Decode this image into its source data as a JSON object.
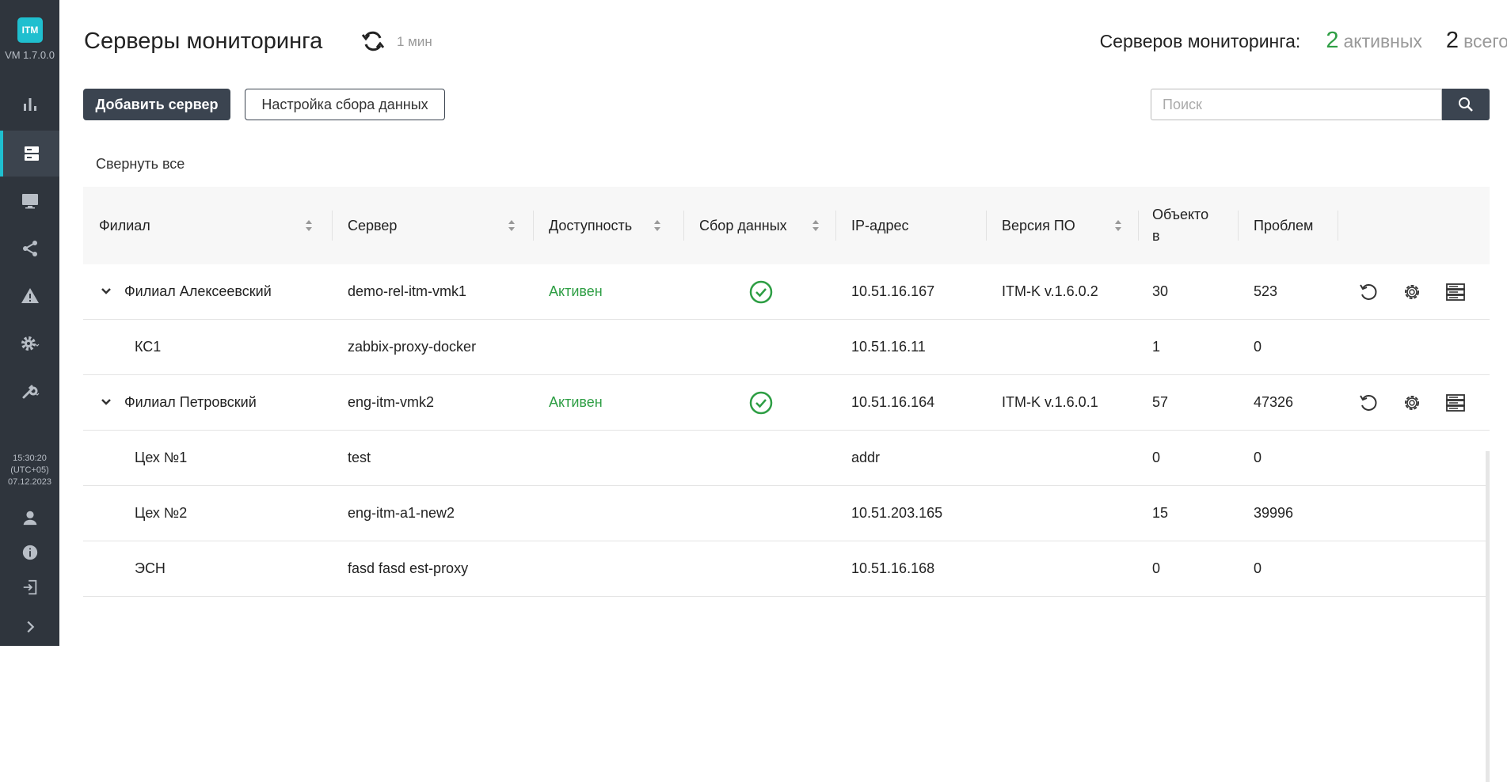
{
  "sidebar": {
    "logo_text": "ITM",
    "version": "VM 1.7.0.0",
    "clock_time": "15:30:20",
    "clock_tz": "(UTC+05)",
    "clock_date": "07.12.2023",
    "nav": [
      {
        "icon": "bar-chart-icon"
      },
      {
        "icon": "servers-icon",
        "active": true
      },
      {
        "icon": "monitor-icon"
      },
      {
        "icon": "share-icon"
      },
      {
        "icon": "warning-icon"
      },
      {
        "icon": "gear-icon"
      },
      {
        "icon": "wrench-icon"
      }
    ],
    "bottom": [
      {
        "icon": "user-icon"
      },
      {
        "icon": "info-icon"
      },
      {
        "icon": "logout-icon"
      },
      {
        "icon": "expand-chevron-icon"
      }
    ],
    "accent_color": "#1fbfcf",
    "bg_color": "#2f353d"
  },
  "header": {
    "title": "Серверы мониторинга",
    "refresh_interval": "1 мин",
    "summary_label": "Серверов мониторинга:",
    "active_count": "2",
    "active_label": "активных",
    "total_count": "2",
    "total_label": "всего"
  },
  "toolbar": {
    "add_server": "Добавить сервер",
    "data_collection_settings": "Настройка сбора данных",
    "search_placeholder": "Поиск",
    "collapse_all": "Свернуть все"
  },
  "table": {
    "columns": [
      "Филиал",
      "Сервер",
      "Доступность",
      "Сбор данных",
      "IP-адрес",
      "Версия ПО",
      "Объекто\nв",
      "Проблем"
    ],
    "rows": [
      {
        "branch": "Филиал Алексеевский",
        "server": "demo-rel-itm-vmk1",
        "availability": "Активен",
        "collect": true,
        "ip": "10.51.16.167",
        "version": "ITM-K v.1.6.0.2",
        "objects": "30",
        "problems": "523",
        "level": 0
      },
      {
        "branch": "КС1",
        "server": "zabbix-proxy-docker",
        "availability": "",
        "collect": false,
        "ip": "10.51.16.11",
        "version": "",
        "objects": "1",
        "problems": "0",
        "level": 1
      },
      {
        "branch": "Филиал Петровский",
        "server": "eng-itm-vmk2",
        "availability": "Активен",
        "collect": true,
        "ip": "10.51.16.164",
        "version": "ITM-K v.1.6.0.1",
        "objects": "57",
        "problems": "47326",
        "level": 0
      },
      {
        "branch": "Цех №1",
        "server": "test",
        "availability": "",
        "collect": false,
        "ip": "addr",
        "version": "",
        "objects": "0",
        "problems": "0",
        "level": 1
      },
      {
        "branch": "Цех №2",
        "server": "eng-itm-a1-new2",
        "availability": "",
        "collect": false,
        "ip": "10.51.203.165",
        "version": "",
        "objects": "15",
        "problems": "39996",
        "level": 1
      },
      {
        "branch": "ЭСН",
        "server": "fasd fasd est-proxy",
        "availability": "",
        "collect": false,
        "ip": "10.51.16.168",
        "version": "",
        "objects": "0",
        "problems": "0",
        "level": 1
      }
    ]
  },
  "colors": {
    "active_green": "#2e9e44",
    "dark_button": "#3b4450"
  }
}
